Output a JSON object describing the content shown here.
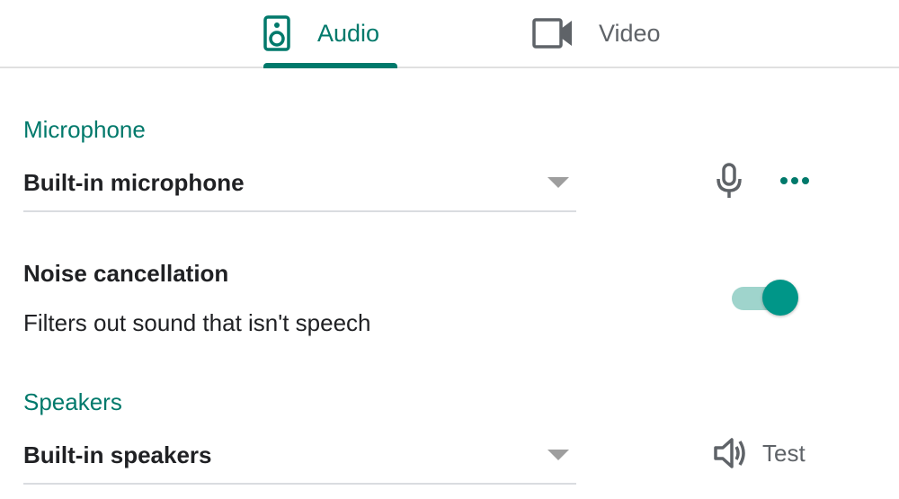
{
  "tabs": [
    {
      "label": "Audio",
      "icon": "speaker-icon",
      "selected": true
    },
    {
      "label": "Video",
      "icon": "videocam-icon",
      "selected": false
    }
  ],
  "microphone": {
    "heading": "Microphone",
    "selected_device": "Built-in microphone",
    "icons": [
      "microphone-icon",
      "more-options-icon"
    ]
  },
  "noise_cancellation": {
    "title": "Noise cancellation",
    "description": "Filters out sound that isn't speech",
    "enabled": true
  },
  "speakers": {
    "heading": "Speakers",
    "selected_device": "Built-in speakers",
    "test_label": "Test",
    "icon": "volume-icon"
  },
  "colors": {
    "accent": "#00796b",
    "toggle_knob": "#009688",
    "toggle_track": "#9fd4cc",
    "text_primary": "#202124",
    "text_secondary": "#5f6368",
    "divider": "#dadce0"
  }
}
